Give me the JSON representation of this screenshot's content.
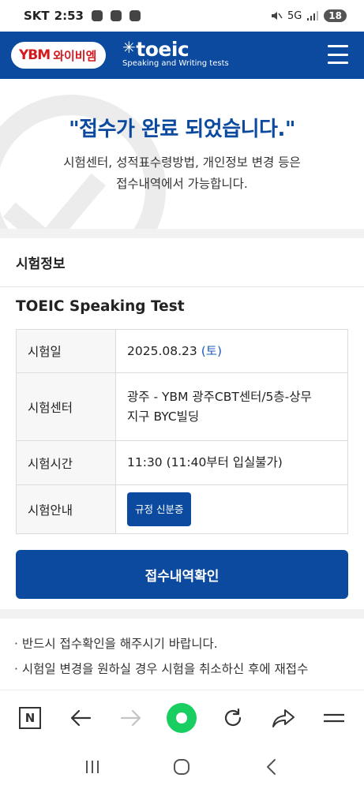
{
  "status_bar": {
    "carrier": "SKT",
    "time": "2:53",
    "network": "5G",
    "battery": "18"
  },
  "header": {
    "ybm_logo_mark": "YBM",
    "ybm_logo_text": "와이비엠",
    "toeic_brand": "toeic",
    "toeic_tagline": "Speaking and Writing tests",
    "menu_icon": "hamburger-icon"
  },
  "hero": {
    "title": "\"접수가 완료 되었습니다.\"",
    "line1": "시험센터, 성적표수령방법, 개인정보 변경 등은",
    "line2": "접수내역에서 가능합니다."
  },
  "exam_info": {
    "section_title": "시험정보",
    "test_name": "TOEIC Speaking Test",
    "rows": [
      {
        "label": "시험일",
        "value": "2025.08.23",
        "day": "(토)"
      },
      {
        "label": "시험센터",
        "value": "광주 - YBM 광주CBT센터/5층-상무",
        "value2": "지구 BYC빌딩"
      },
      {
        "label": "시험시간",
        "value": "11:30 (11:40부터 입실불가)"
      },
      {
        "label": "시험안내",
        "button": "규정 신분증"
      }
    ]
  },
  "confirm_button": "접수내역확인",
  "notes": [
    "· 반드시 접수확인을 해주시기 바랍니다.",
    "· 시험일 변경을 원하실 경우 시험을 취소하신 후에 재접수"
  ],
  "browser_bar": {
    "icons": [
      "naver-n-icon",
      "back-arrow-icon",
      "forward-arrow-icon",
      "green-home-icon",
      "refresh-icon",
      "share-icon",
      "menu-lines-icon"
    ],
    "n_label": "N"
  },
  "nav_bar": {
    "icons": [
      "recent-apps-icon",
      "home-icon",
      "back-icon"
    ]
  },
  "colors": {
    "brand_blue": "#0b4a9f",
    "ybm_red": "#d41a1f",
    "naver_green": "#19ce60"
  }
}
